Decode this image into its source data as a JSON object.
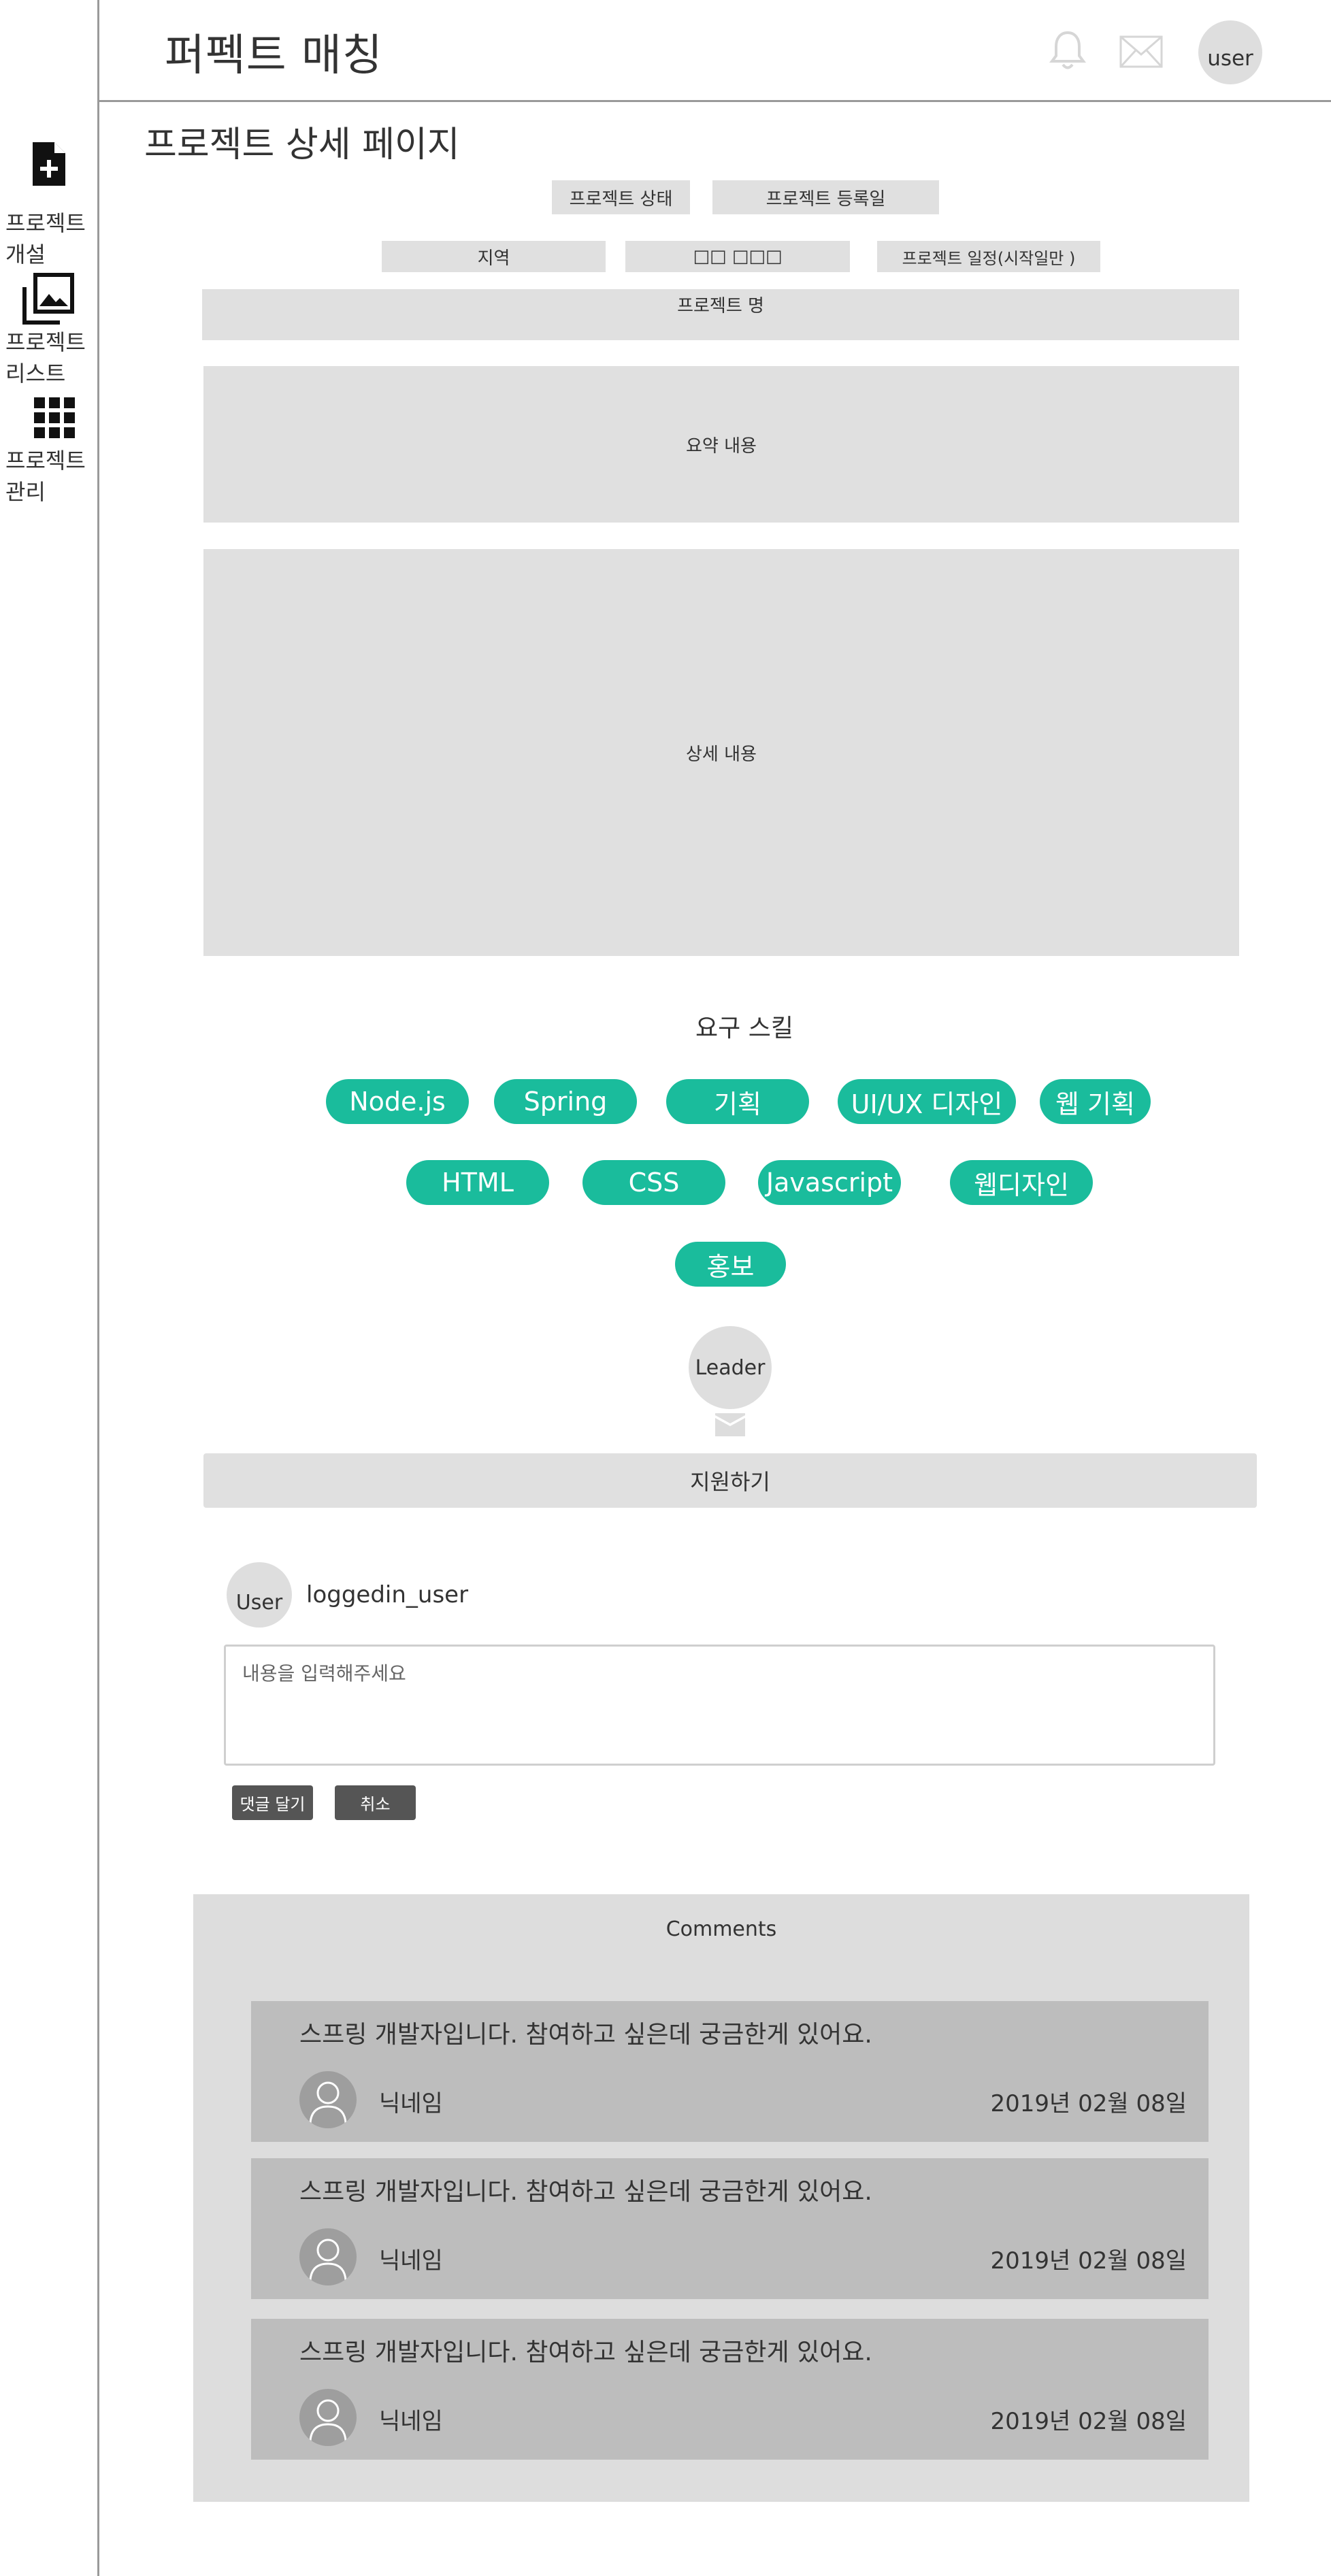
{
  "app": {
    "title": "퍼펙트 매칭"
  },
  "header": {
    "user_label": "user",
    "icons": [
      "bell-icon",
      "mail-icon"
    ]
  },
  "sidebar": {
    "items": [
      {
        "icon": "file-plus-icon",
        "line1": "프로젝트",
        "line2": "개설"
      },
      {
        "icon": "gallery-icon",
        "line1": "프로젝트",
        "line2": "리스트"
      },
      {
        "icon": "grid-icon",
        "line1": "프로젝트",
        "line2": "관리"
      }
    ]
  },
  "page": {
    "title": "프로젝트 상세 페이지"
  },
  "fields": {
    "status": "프로젝트 상태",
    "registered": "프로젝트 등록일",
    "region": "지역",
    "unknown_field": "□□ □□□",
    "schedule": "프로젝트 일정(시작일만 )",
    "name": "프로젝트 명",
    "summary": "요약 내용",
    "detail": "상세 내용"
  },
  "skills": {
    "title": "요구 스킬",
    "items": [
      "Node.js",
      "Spring",
      "기획",
      "UI/UX 디자인",
      "웹 기획",
      "HTML",
      "CSS",
      "Javascript",
      "웹디자인",
      "홍보"
    ]
  },
  "leader": {
    "label": "Leader"
  },
  "apply": {
    "label": "지원하기"
  },
  "comment_form": {
    "avatar_label": "User",
    "username": "loggedin_user",
    "placeholder": "내용을 입력해주세요",
    "submit_label": "댓글 달기",
    "cancel_label": "취소"
  },
  "comments": {
    "heading": "Comments",
    "items": [
      {
        "text": "스프링 개발자입니다. 참여하고 싶은데 궁금한게 있어요.",
        "nickname": "닉네임",
        "date": "2019년 02월 08일"
      },
      {
        "text": "스프링 개발자입니다. 참여하고 싶은데 궁금한게 있어요.",
        "nickname": "닉네임",
        "date": "2019년 02월 08일"
      },
      {
        "text": "스프링 개발자입니다. 참여하고 싶은데 궁금한게 있어요.",
        "nickname": "닉네임",
        "date": "2019년 02월 08일"
      }
    ]
  }
}
